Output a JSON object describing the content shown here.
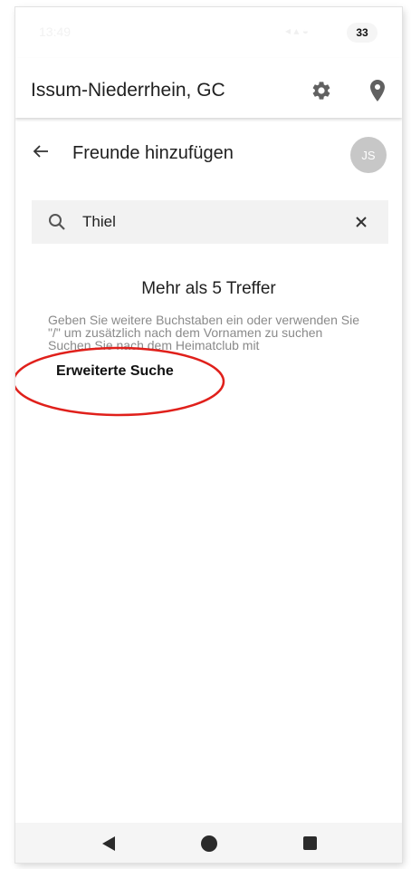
{
  "status_bar": {
    "time": "13:49",
    "battery": "33"
  },
  "app_bar": {
    "title": "Issum-Niederrhein, GC",
    "settings_icon": "gear-icon",
    "location_icon": "location-pin-icon"
  },
  "sub_header": {
    "title": "Freunde hinzufügen",
    "back_icon": "arrow-left-icon",
    "avatar_initials": "JS"
  },
  "search": {
    "value": "Thiel",
    "placeholder": "",
    "icon": "search-icon",
    "clear_icon": "close-icon"
  },
  "results": {
    "title": "Mehr als 5 Treffer",
    "hint_lines": [
      "Geben Sie weitere Buchstaben ein oder verwenden Sie",
      "\"/\" um zusätzlich nach dem Vornamen zu suchen",
      "Suchen Sie nach dem Heimatclub mit"
    ],
    "advanced_search_label": "Erweiterte Suche"
  },
  "annotation": {
    "color": "#e0201b"
  },
  "colors": {
    "text": "#1f1f1f",
    "hint": "#8a8a8a",
    "search_bg": "#f2f2f2",
    "avatar_bg": "#c7c7c7"
  },
  "nav_bar": {
    "back_icon": "triangle-back-icon",
    "home_icon": "circle-home-icon",
    "recents_icon": "square-recents-icon"
  }
}
